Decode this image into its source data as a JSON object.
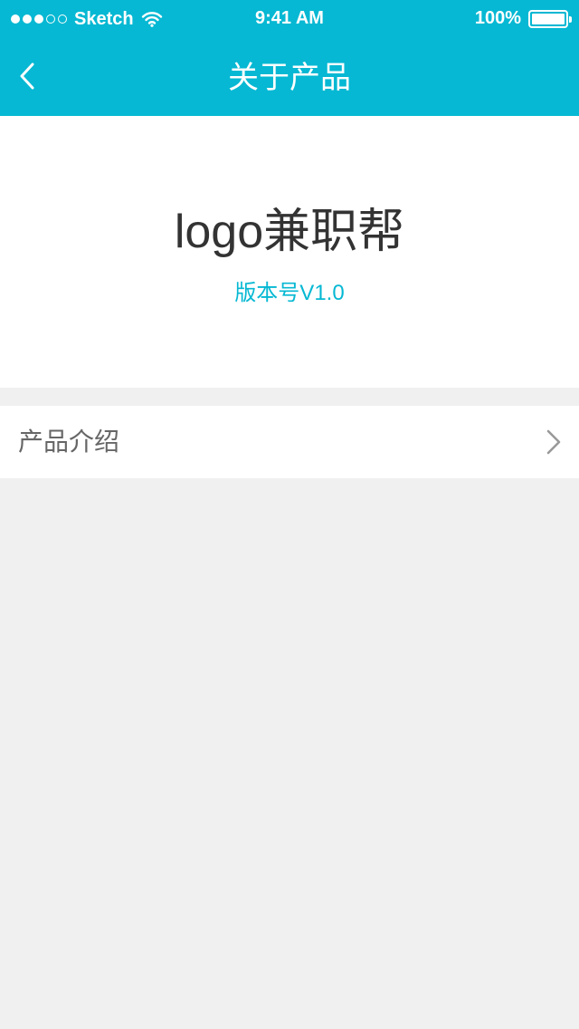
{
  "status_bar": {
    "carrier": "Sketch",
    "time": "9:41 AM",
    "battery": "100%",
    "signal_bars_filled": 3,
    "signal_bars_total": 5,
    "icons": [
      "signal-dots",
      "wifi-icon",
      "battery-icon"
    ]
  },
  "nav": {
    "title": "关于产品",
    "back_icon": "chevron-left-icon"
  },
  "hero": {
    "app_name": "logo兼职帮",
    "version": "版本号V1.0"
  },
  "list": {
    "items": [
      {
        "label": "产品介绍",
        "icon": "chevron-right-icon"
      }
    ]
  },
  "colors": {
    "accent": "#06b8d3",
    "background": "#f0f0f0",
    "card": "#ffffff",
    "title_text": "#333333",
    "label_text": "#666666",
    "chevron": "#999999"
  }
}
